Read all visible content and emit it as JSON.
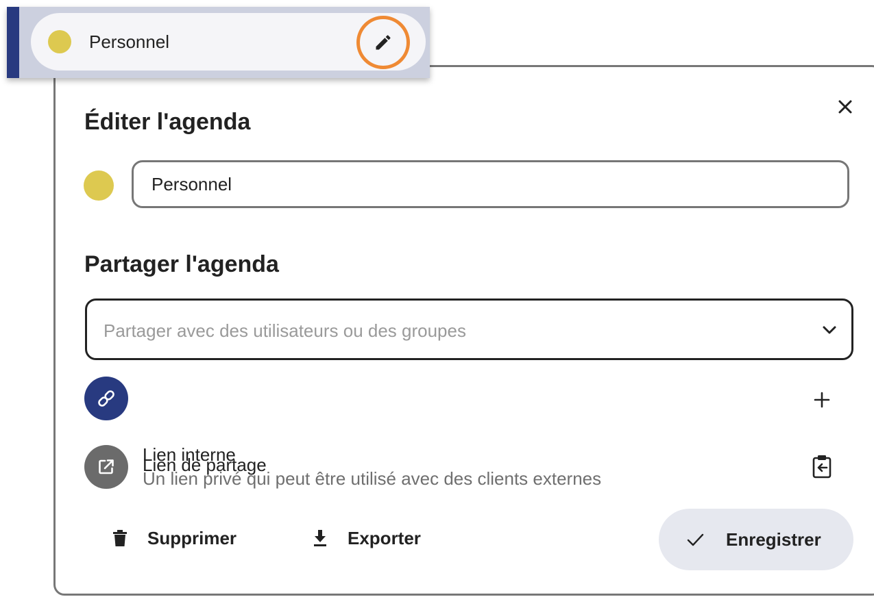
{
  "sidebar": {
    "calendar_name": "Personnel",
    "calendar_color": "#ddc950",
    "edit_icon": "pencil-icon",
    "highlight_color": "#ef8a34",
    "accent_color": "#283a80"
  },
  "dialog": {
    "edit_title": "Éditer l'agenda",
    "name_value": "Personnel",
    "color": "#ddc950",
    "share_title": "Partager l'agenda",
    "share_placeholder": "Partager avec des utilisateurs ou des groupes",
    "share_link": {
      "label": "Lien de partage",
      "icon": "link-icon",
      "action_icon": "plus-icon"
    },
    "internal_link": {
      "label": "Lien interne",
      "description": "Un lien privé qui peut être utilisé avec des clients externes",
      "icon": "open-in-new-icon",
      "action_icon": "clipboard-icon"
    },
    "actions": {
      "delete": "Supprimer",
      "export": "Exporter",
      "save": "Enregistrer"
    }
  }
}
